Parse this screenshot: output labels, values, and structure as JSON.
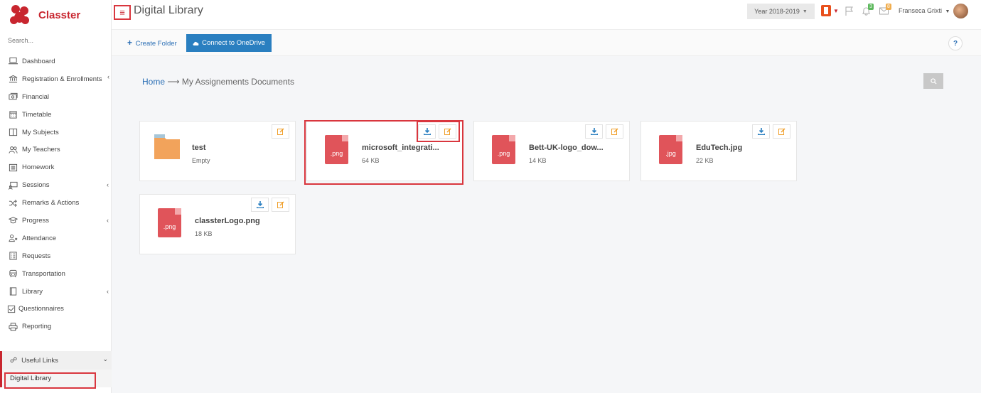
{
  "app": {
    "name": "Classter"
  },
  "sidebar": {
    "search_placeholder": "Search...",
    "items": [
      {
        "label": "Dashboard",
        "icon": "laptop-icon",
        "chevron": false
      },
      {
        "label": "Registration & Enrollments",
        "icon": "bank-icon",
        "chevron": true
      },
      {
        "label": "Financial",
        "icon": "money-icon",
        "chevron": false
      },
      {
        "label": "Timetable",
        "icon": "calendar-icon",
        "chevron": false
      },
      {
        "label": "My Subjects",
        "icon": "columns-icon",
        "chevron": false
      },
      {
        "label": "My Teachers",
        "icon": "users-icon",
        "chevron": false
      },
      {
        "label": "Homework",
        "icon": "list-icon",
        "chevron": false
      },
      {
        "label": "Sessions",
        "icon": "board-icon",
        "chevron": true
      },
      {
        "label": "Remarks & Actions",
        "icon": "shuffle-icon",
        "chevron": false
      },
      {
        "label": "Progress",
        "icon": "graduation-icon",
        "chevron": true
      },
      {
        "label": "Attendance",
        "icon": "user-x-icon",
        "chevron": false
      },
      {
        "label": "Requests",
        "icon": "checklist-icon",
        "chevron": false
      },
      {
        "label": "Transportation",
        "icon": "bus-icon",
        "chevron": false
      },
      {
        "label": "Library",
        "icon": "book-icon",
        "chevron": true
      },
      {
        "label": "Questionnaires",
        "icon": "checkbox-icon",
        "chevron": false
      },
      {
        "label": "Reporting",
        "icon": "printer-icon",
        "chevron": false
      }
    ],
    "useful_links": "Useful Links",
    "digital_library": "Digital Library"
  },
  "header": {
    "menu_icon": "≡",
    "title": "Digital Library",
    "year": "Year 2018-2019",
    "notifications_count": "3",
    "messages_count": "8",
    "user_name": "Franseca Grixti"
  },
  "toolbar": {
    "create_folder": "Create Folder",
    "connect_onedrive": "Connect to OneDrive",
    "help": "?"
  },
  "breadcrumb": {
    "home": "Home",
    "separator": "⟶",
    "current": "My Assignements Documents"
  },
  "files": [
    {
      "name": "test",
      "meta": "Empty",
      "type": "folder"
    },
    {
      "name": "microsoft_integrati...",
      "meta": "64 KB",
      "type": "file",
      "ext": ".png"
    },
    {
      "name": "Bett-UK-logo_dow...",
      "meta": "14 KB",
      "type": "file",
      "ext": ".png"
    },
    {
      "name": "EduTech.jpg",
      "meta": "22 KB",
      "type": "file",
      "ext": ".jpg"
    },
    {
      "name": "classterLogo.png",
      "meta": "18 KB",
      "type": "file",
      "ext": ".png"
    }
  ],
  "colors": {
    "brand": "#c8262f",
    "accent_blue": "#2a7fc0",
    "file_red": "#e0545a",
    "folder_orange": "#f2a35b",
    "edit_orange": "#f0a02d",
    "highlight": "#d9363e"
  }
}
